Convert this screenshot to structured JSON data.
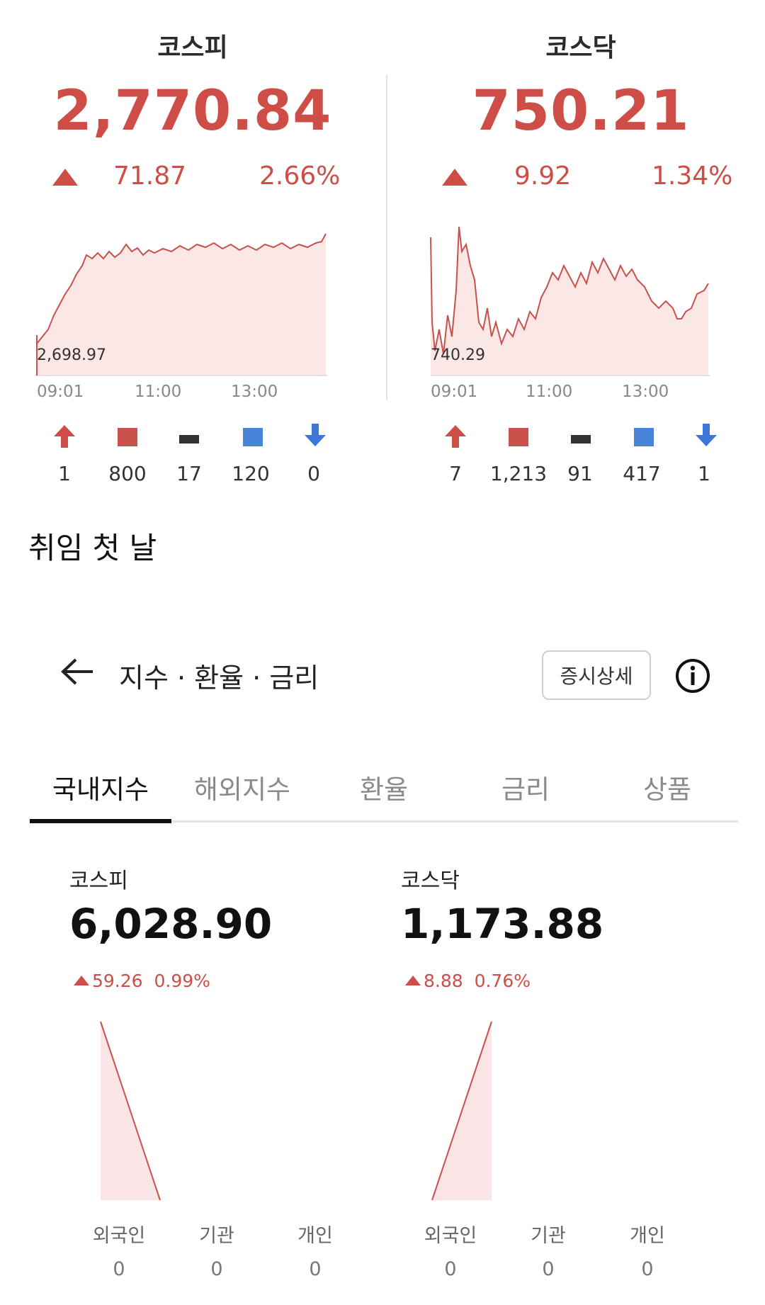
{
  "old_panel": {
    "kospi": {
      "name": "코스피",
      "value": "2,770.84",
      "change": "71.87",
      "percent": "2.66%",
      "low_label": "2,698.97",
      "times": [
        "09:01",
        "11:00",
        "13:00"
      ],
      "counts": [
        "1",
        "800",
        "17",
        "120",
        "0"
      ]
    },
    "kosdaq": {
      "name": "코스닥",
      "value": "750.21",
      "change": "9.92",
      "percent": "1.34%",
      "low_label": "740.29",
      "times": [
        "09:01",
        "11:00",
        "13:00"
      ],
      "counts": [
        "7",
        "1,213",
        "91",
        "417",
        "1"
      ]
    },
    "colors": {
      "up": "#cf4d47",
      "down": "#3b78d8",
      "flat": "#333333",
      "up_box": "#c9514c",
      "down_box": "#4a84d9"
    },
    "count_icons": [
      "upper-limit-arrow-icon",
      "rise-square-icon",
      "flat-dash-icon",
      "fall-square-icon",
      "lower-limit-arrow-icon"
    ]
  },
  "note": "취임 첫 날",
  "header": {
    "title": "지수 · 환율 · 금리",
    "detail_button": "증시상세"
  },
  "tabs": [
    "국내지수",
    "해외지수",
    "환율",
    "금리",
    "상품"
  ],
  "active_tab": "국내지수",
  "new_panel": {
    "kospi": {
      "name": "코스피",
      "value": "6,028.90",
      "change": "59.26",
      "percent": "0.99%"
    },
    "kosdaq": {
      "name": "코스닥",
      "value": "1,173.88",
      "change": "8.88",
      "percent": "0.76%"
    },
    "investors": {
      "labels": [
        "외국인",
        "기관",
        "개인"
      ],
      "kospi_values": [
        "0",
        "0",
        "0"
      ],
      "kosdaq_values": [
        "0",
        "0",
        "0"
      ]
    }
  }
}
